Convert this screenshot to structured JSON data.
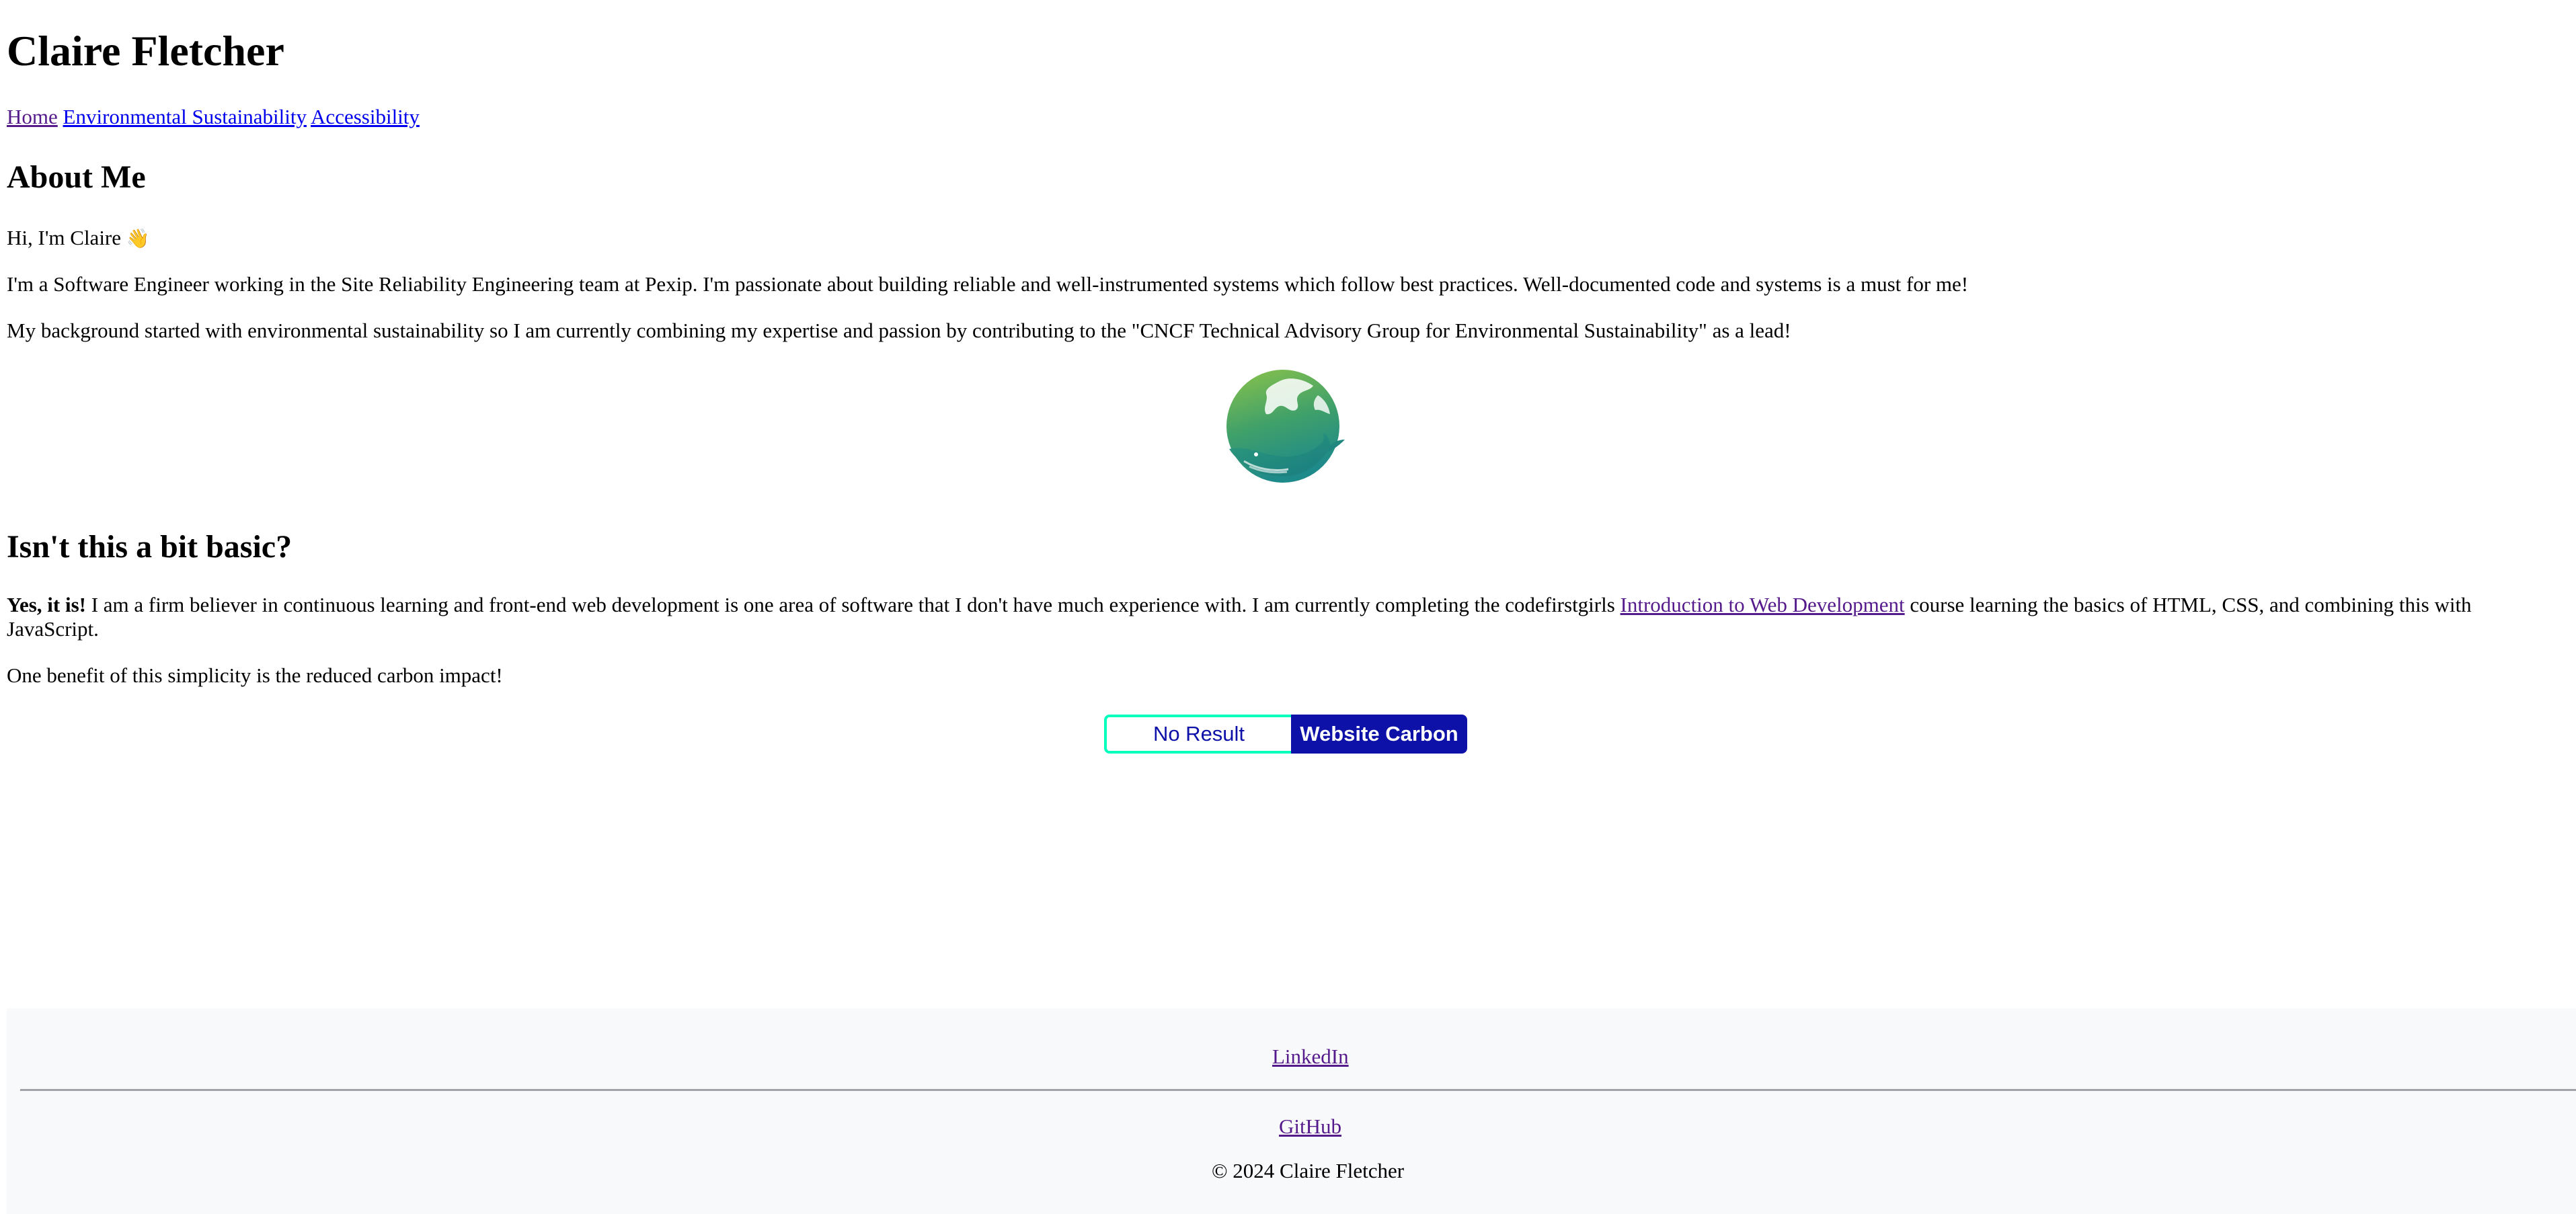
{
  "header": {
    "title": "Claire Fletcher"
  },
  "nav": {
    "items": [
      "Home",
      "Environmental Sustainability",
      "Accessibility"
    ]
  },
  "about": {
    "heading": "About Me",
    "greeting": "Hi, I'm Claire",
    "greeting_emoji": "👋",
    "intro": "I'm a Software Engineer working in the Site Reliability Engineering team at Pexip. I'm passionate about building reliable and well-instrumented systems which follow best practices. Well-documented code and systems is a must for me!",
    "background": "My background started with environmental sustainability so I am currently combining my expertise and passion by contributing to the \"CNCF Technical Advisory Group for Environmental Sustainability\" as a lead!",
    "logo_icon": "earth-whale-logo"
  },
  "basic": {
    "heading": "Isn't this a bit basic?",
    "bold_lead": "Yes, it is!",
    "text_before_link": " I am a firm believer in continuous learning and front-end web development is one area of software that I don't have much experience with. I am currently completing the codefirstgirls ",
    "course_link": "Introduction to Web Development",
    "text_after_link": " course learning the basics of HTML, CSS, and combining this with JavaScript.",
    "benefit": "One benefit of this simplicity is the reduced carbon impact!"
  },
  "carbon_badge": {
    "result": "No Result",
    "link_label": "Website Carbon",
    "colors": {
      "accent": "#0e11a8",
      "border": "#00ffbc"
    }
  },
  "footer": {
    "linkedin": "LinkedIn",
    "github": "GitHub",
    "copyright": "© 2024 Claire Fletcher",
    "background": "#f8f9fa"
  }
}
